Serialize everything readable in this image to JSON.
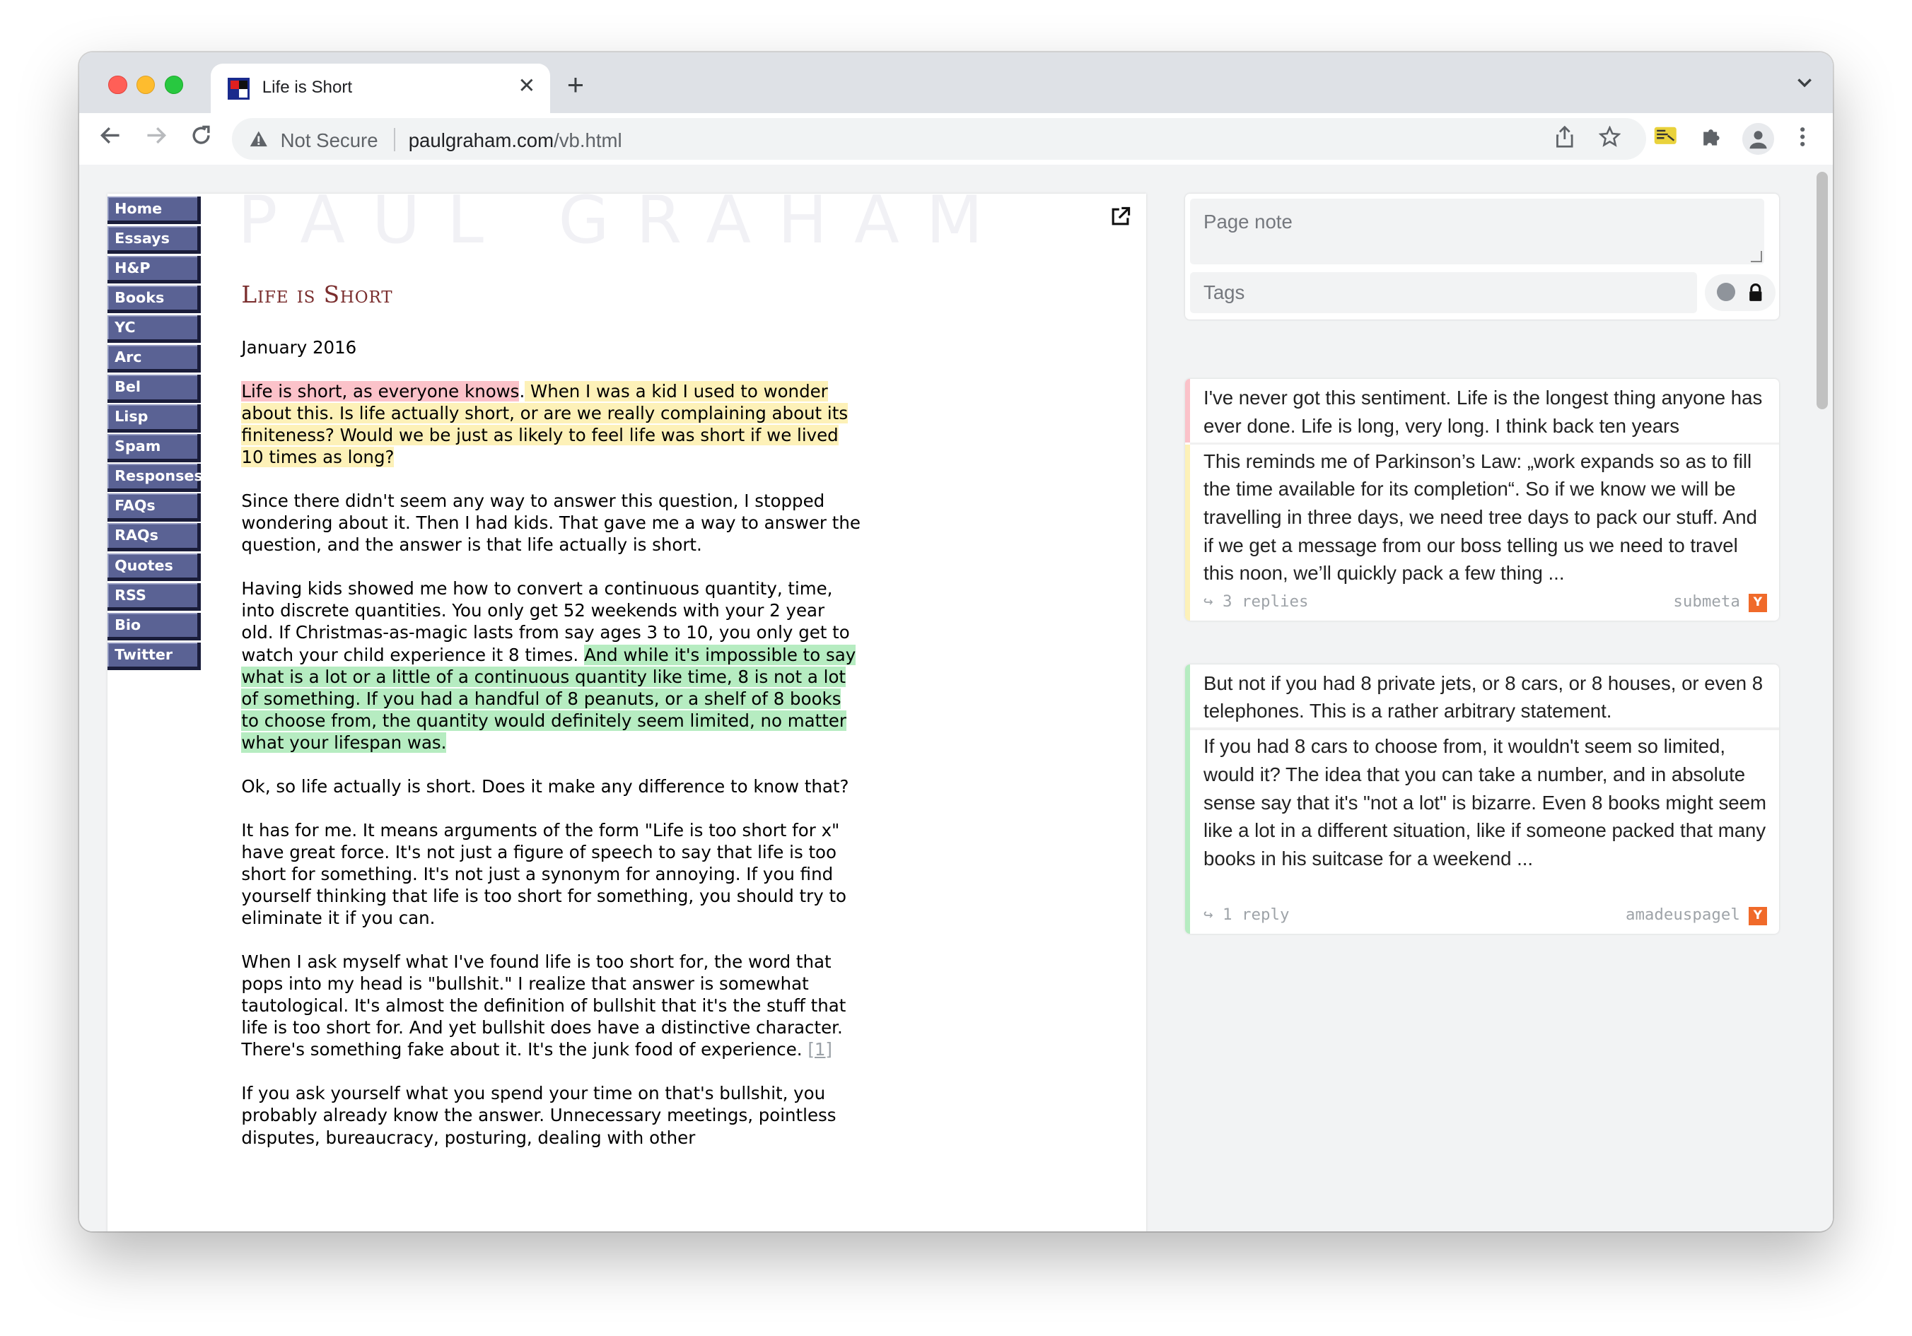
{
  "browser": {
    "tab_title": "Life is Short",
    "url_security": "Not Secure",
    "url_host": "paulgraham.com",
    "url_path": "/vb.html",
    "accent_red": "#ff5f57",
    "accent_yellow": "#febc2e",
    "accent_green": "#28c840"
  },
  "site": {
    "logo": "PAUL GRAHAM",
    "nav": [
      "Home",
      "Essays",
      "H&P",
      "Books",
      "YC",
      "Arc",
      "Bel",
      "Lisp",
      "Spam",
      "Responses",
      "FAQs",
      "RAQs",
      "Quotes",
      "RSS",
      "Bio",
      "Twitter"
    ],
    "nav_color": "#5a6294"
  },
  "essay": {
    "title": "Life is Short",
    "date": "January 2016",
    "p1_red": "Life is short, as everyone knows",
    "p1_dot": ".",
    "p1_yellow": " When I was a kid I used to wonder about this. Is life actually short, or are we really complaining about its finiteness? Would we be just as likely to feel life was short if we lived 10 times as long?",
    "p2": "Since there didn't seem any way to answer this question, I stopped wondering about it. Then I had kids. That gave me a way to answer the question, and the answer is that life actually is short.",
    "p3_plain": "Having kids showed me how to convert a continuous quantity, time, into discrete quantities. You only get 52 weekends with your 2 year old. If Christmas-as-magic lasts from say ages 3 to 10, you only get to watch your child experience it 8 times. ",
    "p3_green": "And while it's impossible to say what is a lot or a little of a continuous quantity like time, 8 is not a lot of something. If you had a handful of 8 peanuts, or a shelf of 8 books to choose from, the quantity would definitely seem limited, no matter what your lifespan was.",
    "p4": "Ok, so life actually is short. Does it make any difference to know that?",
    "p5": "It has for me. It means arguments of the form \"Life is too short for x\" have great force. It's not just a figure of speech to say that life is too short for something. It's not just a synonym for annoying. If you find yourself thinking that life is too short for something, you should try to eliminate it if you can.",
    "p6": "When I ask myself what I've found life is too short for, the word that pops into my head is \"bullshit.\" I realize that answer is somewhat tautological. It's almost the definition of bullshit that it's the stuff that life is too short for. And yet bullshit does have a distinctive character. There's something fake about it. It's the junk food of experience. ",
    "p6_footnote": "[1]",
    "p7": "If you ask yourself what you spend your time on that's bullshit, you probably already know the answer. Unnecessary meetings, pointless disputes, bureaucracy, posturing, dealing with other"
  },
  "sidebar": {
    "page_note_placeholder": "Page note",
    "tags_placeholder": "Tags",
    "cards": [
      {
        "quote": "I've never got this sentiment. Life is the longest thing anyone has ever done. Life is long, very long. I think back ten years",
        "comment": "This reminds me of Parkinson’s Law: „work expands so as to fill the time available for its completion“. So if we know we will be travelling in three days, we need tree days to pack our stuff. And if we get a message from our boss telling us we need to travel this noon, we’ll quickly pack a few thing ...",
        "replies": "3 replies",
        "user": "submeta",
        "badge": "Y",
        "highlight_color": "#fbc2c9",
        "comment_bar_color": "#fdf1b8"
      },
      {
        "quote": "But not if you had 8 private jets, or 8 cars, or 8 houses, or even 8 telephones. This is a rather arbitrary statement.",
        "comment": "If you had 8 cars to choose from, it wouldn't seem so limited, would it? The idea that you can take a number, and in absolute sense say that it's \"not a lot\" is bizarre. Even 8 books might seem like a lot in a different situation, like if someone packed that many books in his suitcase for a weekend ...",
        "replies": "1 reply",
        "user": "amadeuspagel",
        "badge": "Y",
        "highlight_color": "#b6ecc1",
        "comment_bar_color": "#b6ecc1"
      }
    ]
  }
}
